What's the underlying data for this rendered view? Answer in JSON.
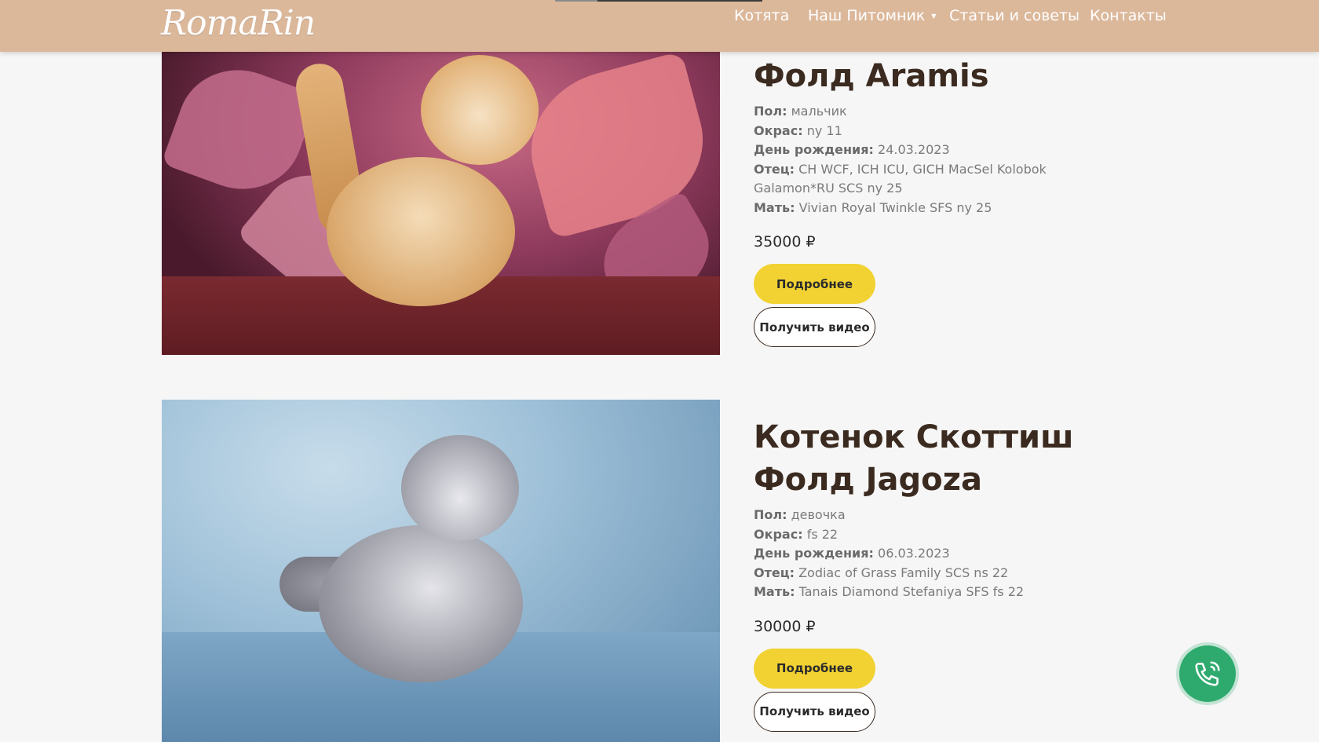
{
  "header": {
    "logo_text": "RomaRin",
    "nav": {
      "kittens": "Котята",
      "cattery": "Наш Питомник",
      "articles": "Статьи и советы",
      "contacts": "Контакты"
    }
  },
  "kittens": [
    {
      "title": "Фолд Aramis",
      "labels": {
        "sex": "Пол:",
        "color": "Окрас:",
        "birthday": "День рождения:",
        "father": "Отец:",
        "mother": "Мать:"
      },
      "sex": "мальчик",
      "color": "ny 11",
      "birthday": "24.03.2023",
      "father": "CH WCF, ICH ICU, GICH MacSel Kolobok Galamon*RU SCS ny 25",
      "mother": "Vivian Royal Twinkle SFS ny 25",
      "price": "35000 ₽",
      "more_label": "Подробнее",
      "video_label": "Получить видео"
    },
    {
      "title_line1": "Котенок Скоттиш",
      "title_line2": "Фолд Jagoza",
      "labels": {
        "sex": "Пол:",
        "color": "Окрас:",
        "birthday": "День рождения:",
        "father": "Отец:",
        "mother": "Мать:"
      },
      "sex": "девочка",
      "color": "fs 22",
      "birthday": "06.03.2023",
      "father": "Zodiac of Grass Family SCS ns 22",
      "mother": "Tanais Diamond Stefaniya SFS fs 22",
      "price": "30000 ₽",
      "more_label": "Подробнее",
      "video_label": "Получить видео"
    }
  ],
  "icons": {
    "call": "phone-icon",
    "dropdown": "chevron-down-icon"
  },
  "colors": {
    "header_bg": "#dcb89b",
    "primary_button": "#f2d232",
    "call_button": "#2faa6e"
  }
}
